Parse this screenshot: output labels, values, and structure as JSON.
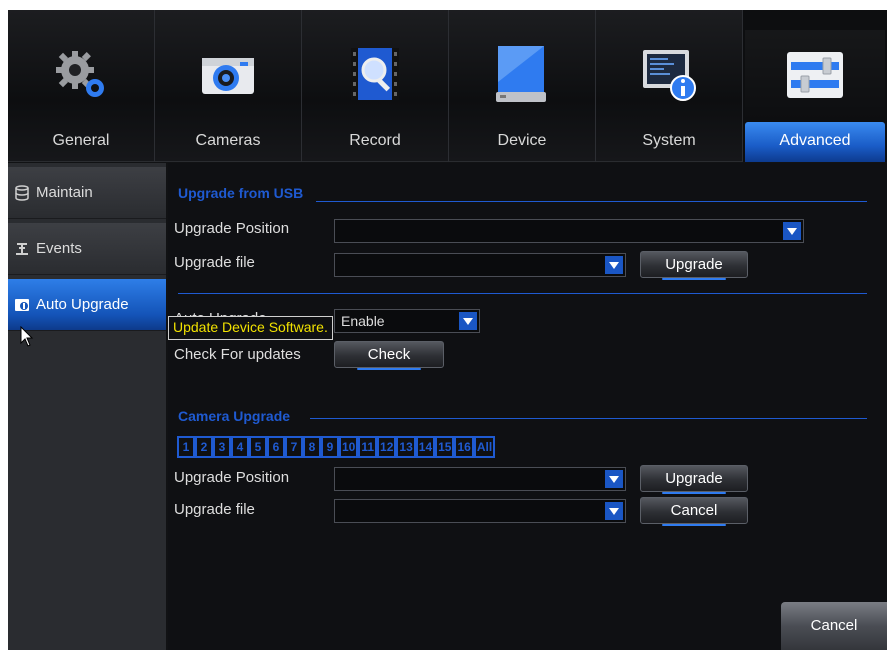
{
  "tabs": [
    {
      "label": "General",
      "icon": "gears-icon"
    },
    {
      "label": "Cameras",
      "icon": "camera-icon"
    },
    {
      "label": "Record",
      "icon": "record-magnifier-icon"
    },
    {
      "label": "Device",
      "icon": "hard-drive-icon"
    },
    {
      "label": "System",
      "icon": "system-info-icon"
    },
    {
      "label": "Advanced",
      "icon": "sliders-icon",
      "active": true
    }
  ],
  "sidebar": {
    "items": [
      {
        "label": "Maintain",
        "icon": "database-icon"
      },
      {
        "label": "Events",
        "icon": "events-icon"
      },
      {
        "label": "Auto Upgrade",
        "icon": "upgrade-icon",
        "active": true
      }
    ]
  },
  "usb": {
    "title": "Upgrade from USB",
    "position_label": "Upgrade Position",
    "position_value": "",
    "file_label": "Upgrade file",
    "file_value": "",
    "upgrade_button": "Upgrade"
  },
  "auto": {
    "enable_label": "Auto Upgrade",
    "enable_value": "Enable",
    "check_label": "Check For updates",
    "check_button": "Check",
    "tooltip": "Update Device Software."
  },
  "camera": {
    "title": "Camera Upgrade",
    "channels": [
      "1",
      "2",
      "3",
      "4",
      "5",
      "6",
      "7",
      "8",
      "9",
      "10",
      "11",
      "12",
      "13",
      "14",
      "15",
      "16",
      "All"
    ],
    "position_label": "Upgrade Position",
    "position_value": "",
    "file_label": "Upgrade file",
    "file_value": "",
    "upgrade_button": "Upgrade",
    "cancel_button": "Cancel"
  },
  "footer": {
    "cancel_button": "Cancel"
  },
  "colors": {
    "accent": "#1f5ad1",
    "active_tab": "#2e7ee8",
    "tooltip_text": "#f2e200"
  }
}
